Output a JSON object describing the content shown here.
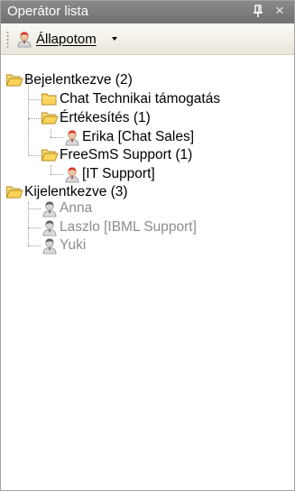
{
  "panel": {
    "title": "Operátor lista",
    "pin_icon": "pin-icon",
    "close_glyph": "×"
  },
  "toolbar": {
    "status_label": "Állapotom",
    "status_icon": "operator-avatar-icon"
  },
  "tree": {
    "groups": [
      {
        "label": "Bejelentkezve (2)",
        "children": [
          {
            "label": "Chat Technikai támogatás"
          },
          {
            "label": "Értékesítés (1)",
            "children": [
              {
                "label": "Erika [Chat Sales]"
              }
            ]
          },
          {
            "label": "FreeSmS Support (1)",
            "children": [
              {
                "label": "[IT Support]"
              }
            ]
          }
        ]
      },
      {
        "label": "Kijelentkezve (3)",
        "children": [
          {
            "label": "Anna"
          },
          {
            "label": "Laszlo [IBML Support]"
          },
          {
            "label": "Yuki"
          }
        ]
      }
    ]
  },
  "colors": {
    "titlebar": "#7d7d7d",
    "folder": "#f5cf5a",
    "online_avatar": "#e04848",
    "offline_text": "#8c8c8c"
  }
}
